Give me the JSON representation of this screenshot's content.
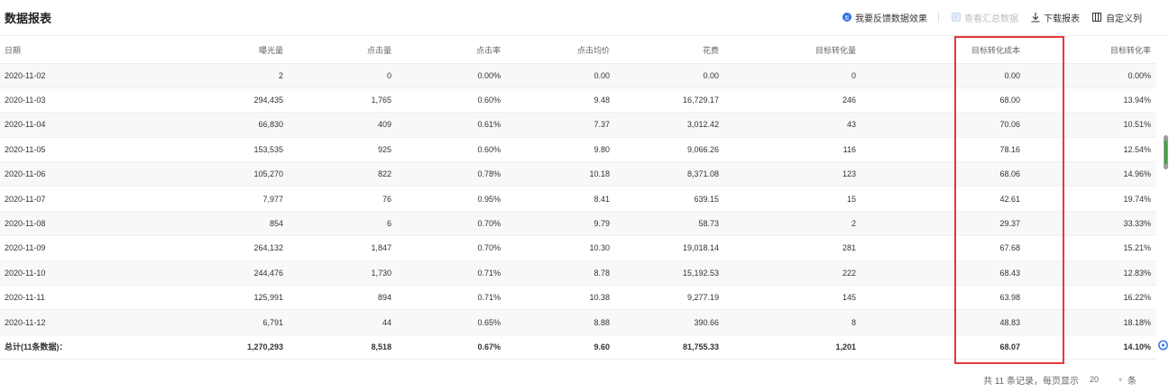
{
  "header": {
    "title": "数据报表",
    "feedback_label": "我要反馈数据效果",
    "feedback_icon_text": "反",
    "summary_label": "查看汇总数据",
    "download_label": "下载报表",
    "custom_columns_label": "自定义列"
  },
  "table": {
    "columns": [
      "日期",
      "曝光量",
      "点击量",
      "点击率",
      "点击均价",
      "花费",
      "目标转化量",
      "目标转化成本",
      "目标转化率"
    ],
    "rows": [
      [
        "2020-11-02",
        "2",
        "0",
        "0.00%",
        "0.00",
        "0.00",
        "0",
        "0.00",
        "0.00%"
      ],
      [
        "2020-11-03",
        "294,435",
        "1,765",
        "0.60%",
        "9.48",
        "16,729.17",
        "246",
        "68.00",
        "13.94%"
      ],
      [
        "2020-11-04",
        "66,830",
        "409",
        "0.61%",
        "7.37",
        "3,012.42",
        "43",
        "70.06",
        "10.51%"
      ],
      [
        "2020-11-05",
        "153,535",
        "925",
        "0.60%",
        "9.80",
        "9,066.26",
        "116",
        "78.16",
        "12.54%"
      ],
      [
        "2020-11-06",
        "105,270",
        "822",
        "0.78%",
        "10.18",
        "8,371.08",
        "123",
        "68.06",
        "14.96%"
      ],
      [
        "2020-11-07",
        "7,977",
        "76",
        "0.95%",
        "8.41",
        "639.15",
        "15",
        "42.61",
        "19.74%"
      ],
      [
        "2020-11-08",
        "854",
        "6",
        "0.70%",
        "9.79",
        "58.73",
        "2",
        "29.37",
        "33.33%"
      ],
      [
        "2020-11-09",
        "264,132",
        "1,847",
        "0.70%",
        "10.30",
        "19,018.14",
        "281",
        "67.68",
        "15.21%"
      ],
      [
        "2020-11-10",
        "244,476",
        "1,730",
        "0.71%",
        "8.78",
        "15,192.53",
        "222",
        "68.43",
        "12.83%"
      ],
      [
        "2020-11-11",
        "125,991",
        "894",
        "0.71%",
        "10.38",
        "9,277.19",
        "145",
        "63.98",
        "16.22%"
      ],
      [
        "2020-11-12",
        "6,791",
        "44",
        "0.65%",
        "8.88",
        "390.66",
        "8",
        "48.83",
        "18.18%"
      ]
    ],
    "total": [
      "总计(11条数据)：",
      "1,270,293",
      "8,518",
      "0.67%",
      "9.60",
      "81,755.33",
      "1,201",
      "68.07",
      "14.10%"
    ]
  },
  "pagination": {
    "summary": "共 11 条记录，每页显示",
    "page_size": "20",
    "unit": "条"
  },
  "colors": {
    "highlight": "#e53935",
    "accent": "#2f6fe4"
  }
}
